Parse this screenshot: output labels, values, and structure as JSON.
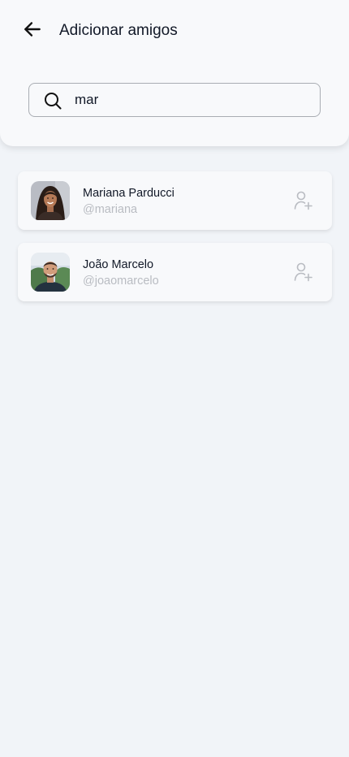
{
  "header": {
    "title": "Adicionar amigos",
    "back_icon": "arrow-left-icon"
  },
  "search": {
    "value": "mar",
    "icon": "search-icon"
  },
  "results": [
    {
      "name": "Mariana Parducci",
      "handle": "@mariana",
      "avatar": "woman-avatar-photo",
      "action_icon": "add-user-icon"
    },
    {
      "name": "João Marcelo",
      "handle": "@joaomarcelo",
      "avatar": "man-avatar-photo",
      "action_icon": "add-user-icon"
    }
  ],
  "colors": {
    "background": "#f1f4f8",
    "surface": "#f8f9fb",
    "text": "#111827",
    "muted": "#b9bcc2",
    "border": "#a9adb3"
  }
}
